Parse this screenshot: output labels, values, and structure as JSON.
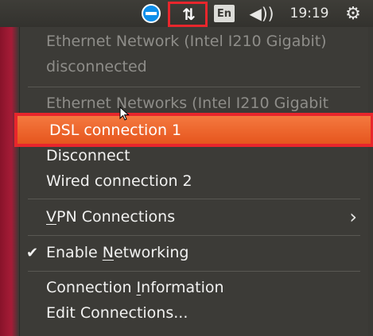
{
  "panel": {
    "teamviewer_icon": "teamviewer-icon",
    "network_icon": "network-arrows-icon",
    "network_glyph": "⇅",
    "keyboard_layout": "En",
    "sound_icon": "speaker-volume-icon",
    "sound_glyph": "◀))",
    "clock": "19:19",
    "gear_icon": "system-gear-icon",
    "gear_glyph": "⚙"
  },
  "menu": {
    "ethernet_line1": "Ethernet Network (Intel I210 Gigabit)",
    "ethernet_line2": "disconnected",
    "ethernet_networks_header": "Ethernet Networks (Intel I210 Gigabit",
    "dsl_connection": "DSL connection 1",
    "disconnect": "Disconnect",
    "wired_connection": "Wired connection 2",
    "vpn_prefix": "V",
    "vpn_rest": "PN Connections",
    "vpn_chevron": "›",
    "enable_check": "✔",
    "enable_prefix": "Enable ",
    "enable_key": "N",
    "enable_rest": "etworking",
    "conn_info_prefix": "Connection ",
    "conn_info_key": "I",
    "conn_info_rest": "nformation",
    "edit_connections": "Edit Connections..."
  },
  "colors": {
    "panel_bg": "#3c3b37",
    "menu_bg": "#3c3b37",
    "highlight": "#f07746",
    "annotation_red": "#e8262c",
    "disabled_text": "#8e8d89"
  }
}
